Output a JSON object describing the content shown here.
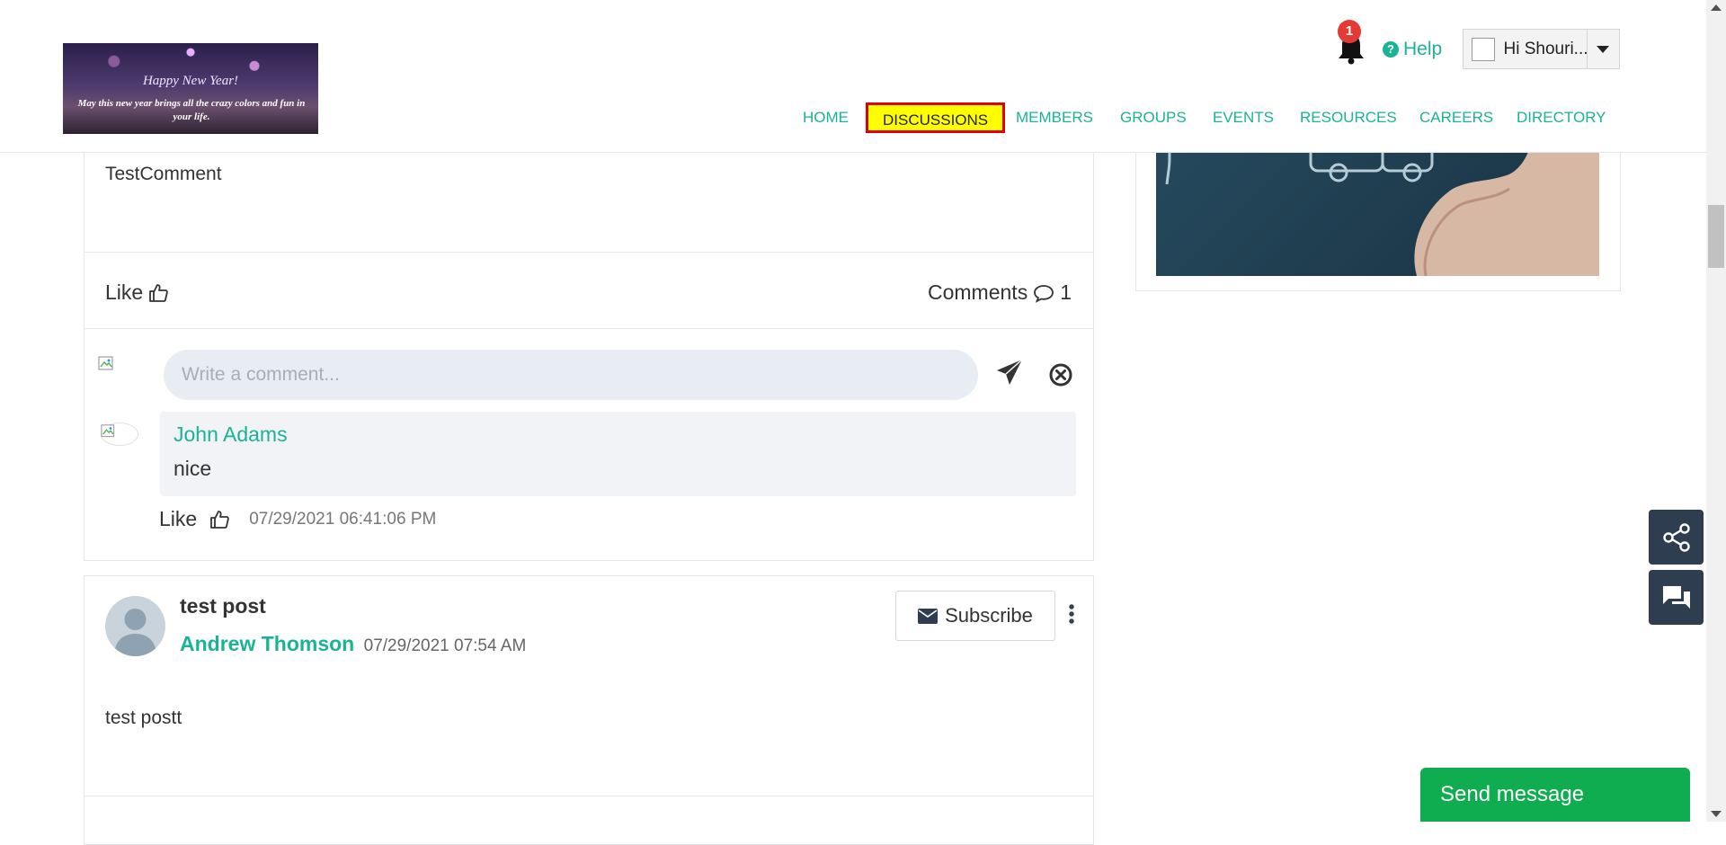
{
  "header": {
    "logo": {
      "line1": "Happy New Year!",
      "line2": "May this new year brings all the crazy colors and fun in your life."
    },
    "notifications": {
      "count": "1"
    },
    "help_label": "Help",
    "user": {
      "greeting": "Hi Shouri..."
    },
    "nav": [
      "HOME",
      "DISCUSSIONS",
      "MEMBERS",
      "GROUPS",
      "EVENTS",
      "RESOURCES",
      "CAREERS",
      "DIRECTORY"
    ],
    "active_nav": "DISCUSSIONS"
  },
  "comment_card": {
    "text": "TestComment",
    "like_label": "Like",
    "comments_label": "Comments",
    "comments_count": "1",
    "input_placeholder": "Write a comment...",
    "reply": {
      "author": "John Adams",
      "text": "nice",
      "like_label": "Like",
      "timestamp": "07/29/2021 06:41:06 PM"
    }
  },
  "post": {
    "title": "test post",
    "author": "Andrew Thomson",
    "date": "07/29/2021 07:54 AM",
    "subscribe_label": "Subscribe",
    "body": "test postt"
  },
  "send_message_label": "Send message",
  "colors": {
    "accent": "#1ab394",
    "active_nav_bg": "#ffff00",
    "active_nav_border": "#e00000",
    "send_message": "#0fad4f",
    "floating_buttons": "#2e3d4f",
    "badge": "#e53935"
  }
}
